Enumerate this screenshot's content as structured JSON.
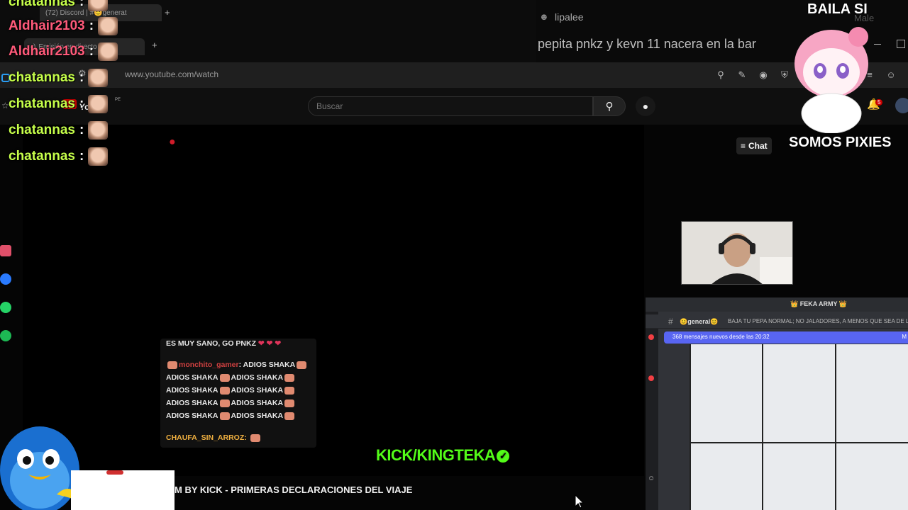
{
  "browser": {
    "tabs": [
      {
        "label": "(72) Discord | #😊generat"
      },
      {
        "label": "Emisión en directo de"
      }
    ],
    "url": "www.youtube.com/watch",
    "profile_name": "lipalee",
    "window_title": "pepita pnkz y kevn 11 nacera en la bar",
    "faint_text": "Male"
  },
  "youtube": {
    "search_placeholder": "Buscar",
    "notification_count": "5",
    "chat_button": "Chat",
    "video_title": "M BY KICK - PRIMERAS DECLARACIONES DEL VIAJE",
    "logo_fragment": "You",
    "logo_sup": "PE"
  },
  "overlay_chat": [
    {
      "user": "chatannas",
      "color": "#c6ff4a"
    },
    {
      "user": "Aldhair2103",
      "color": "#ff5a7a"
    },
    {
      "user": "Aldhair2103",
      "color": "#ff5a7a"
    },
    {
      "user": "chatannas",
      "color": "#c6ff4a"
    },
    {
      "user": "chatannas",
      "color": "#c6ff4a"
    },
    {
      "user": "chatannas",
      "color": "#c6ff4a"
    },
    {
      "user": "chatannas",
      "color": "#c6ff4a"
    }
  ],
  "separator": ":",
  "kick_chat": {
    "top_line": "ES MUY SANO, GO PNKZ",
    "user": "monchito_gamer",
    "first_msg": "ADIOS SHAKA",
    "repeat_msg": "ADIOS SHAKA",
    "chaufa_user": "CHAUFA_SIN_ARROZ"
  },
  "kick_brand": "KICK/KINGTEKA",
  "verified_mark": "✓",
  "sticker": {
    "top_text": "BAILA SI",
    "bottom_text": "SOMOS PIXIES"
  },
  "discord": {
    "server_name": "👑 FEKA ARMY 👑",
    "channel": "😊general😊",
    "topic": "BAJA TU PEPA NORMAL; NO JALADORES, A MENOS QUE SEA DE LA",
    "new_messages": "368 mensajes nuevos desde las 20:32",
    "new_messages_tail": "M"
  },
  "colors": {
    "kick_green": "#53fc18",
    "discord_blurple": "#5865f2",
    "yt_bg": "#0f0f0f"
  }
}
